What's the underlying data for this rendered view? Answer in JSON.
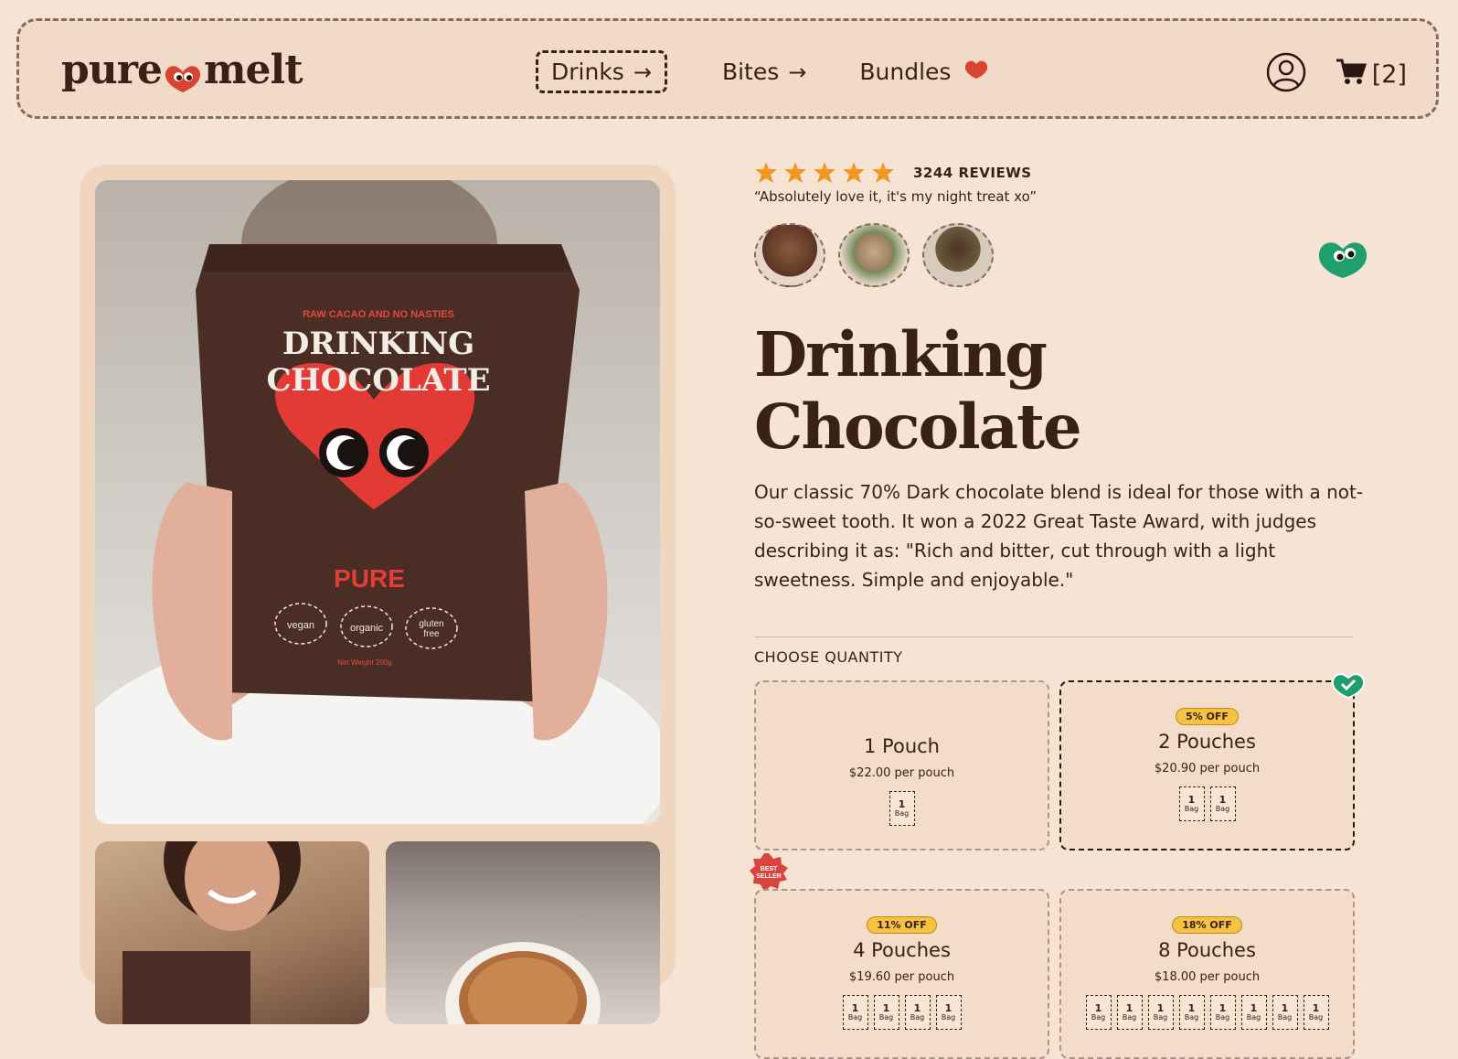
{
  "brand": {
    "name_left": "pure",
    "name_right": "melt",
    "accent": "#d8442f",
    "mascot_green": "#1f9e6e"
  },
  "nav": {
    "items": [
      {
        "label": "Drinks",
        "arrow": "→"
      },
      {
        "label": "Bites",
        "arrow": "→"
      },
      {
        "label": "Bundles"
      }
    ],
    "cart_count": "[2]"
  },
  "product": {
    "reviews": "3244 REVIEWS",
    "rating_stars": 5,
    "quote": "“Absolutely love it, it's my night treat xo”",
    "title": "Drinking Chocolate",
    "description": "Our classic 70% Dark chocolate blend is ideal for those with a not-so-sweet tooth. It won a 2022 Great Taste Award, with judges describing it as: \"Rich and bitter, cut through with a light sweetness. Simple and enjoyable.\"",
    "pack": {
      "tagline": "RAW CACAO AND NO NASTIES",
      "line1": "DRINKING",
      "line2": "CHOCOLATE",
      "brand": "PURE",
      "tag1": "vegan",
      "tag2": "organic",
      "tag3a": "gluten",
      "tag3b": "free",
      "weight": "Net Weight 200g"
    }
  },
  "quantity": {
    "label": "CHOOSE QUANTITY",
    "best_seller_a": "BEST",
    "best_seller_b": "SELLER",
    "bag_num": "1",
    "bag_word": "Bag",
    "options": [
      {
        "title": "1 Pouch",
        "price": "$22.00 per pouch",
        "badge": "",
        "bags": 1
      },
      {
        "title": "2 Pouches",
        "price": "$20.90 per pouch",
        "badge": "5% OFF",
        "bags": 2
      },
      {
        "title": "4 Pouches",
        "price": "$19.60 per pouch",
        "badge": "11% OFF",
        "bags": 4
      },
      {
        "title": "8 Pouches",
        "price": "$18.00 per pouch",
        "badge": "18% OFF",
        "bags": 8
      }
    ],
    "selected_index": 1
  }
}
